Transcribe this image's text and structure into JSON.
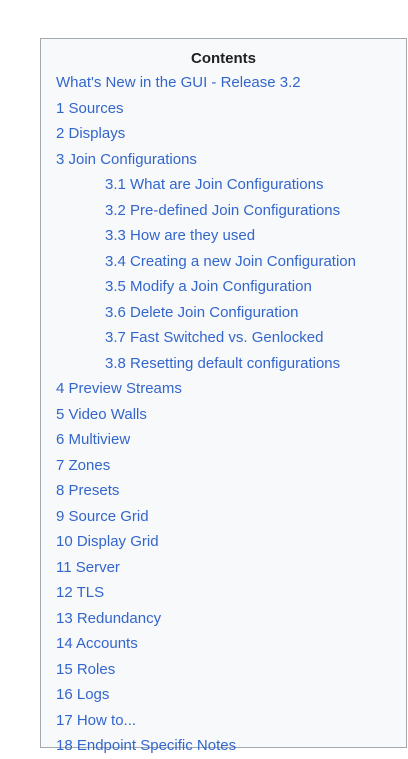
{
  "toc": {
    "title": "Contents",
    "items": [
      {
        "label": "What's New in the GUI - Release 3.2",
        "level": 1
      },
      {
        "label": "1 Sources",
        "level": 1
      },
      {
        "label": "2 Displays",
        "level": 1
      },
      {
        "label": "3 Join Configurations",
        "level": 1
      },
      {
        "label": "3.1 What are Join Configurations",
        "level": 2
      },
      {
        "label": "3.2 Pre-defined Join Configurations",
        "level": 2
      },
      {
        "label": "3.3 How are they used",
        "level": 2
      },
      {
        "label": "3.4 Creating a new Join Configuration",
        "level": 2
      },
      {
        "label": "3.5 Modify a Join Configuration",
        "level": 2
      },
      {
        "label": "3.6 Delete Join Configuration",
        "level": 2
      },
      {
        "label": "3.7 Fast Switched vs. Genlocked",
        "level": 2
      },
      {
        "label": "3.8 Resetting default configurations",
        "level": 2
      },
      {
        "label": "4 Preview Streams",
        "level": 1
      },
      {
        "label": "5 Video Walls",
        "level": 1
      },
      {
        "label": "6 Multiview",
        "level": 1
      },
      {
        "label": "7 Zones",
        "level": 1
      },
      {
        "label": "8 Presets",
        "level": 1
      },
      {
        "label": "9 Source Grid",
        "level": 1
      },
      {
        "label": "10 Display Grid",
        "level": 1
      },
      {
        "label": "11 Server",
        "level": 1
      },
      {
        "label": "12 TLS",
        "level": 1
      },
      {
        "label": "13 Redundancy",
        "level": 1
      },
      {
        "label": "14 Accounts",
        "level": 1
      },
      {
        "label": "15 Roles",
        "level": 1
      },
      {
        "label": "16 Logs",
        "level": 1
      },
      {
        "label": "17 How to...",
        "level": 1
      },
      {
        "label": "18 Endpoint Specific Notes",
        "level": 1
      }
    ]
  }
}
